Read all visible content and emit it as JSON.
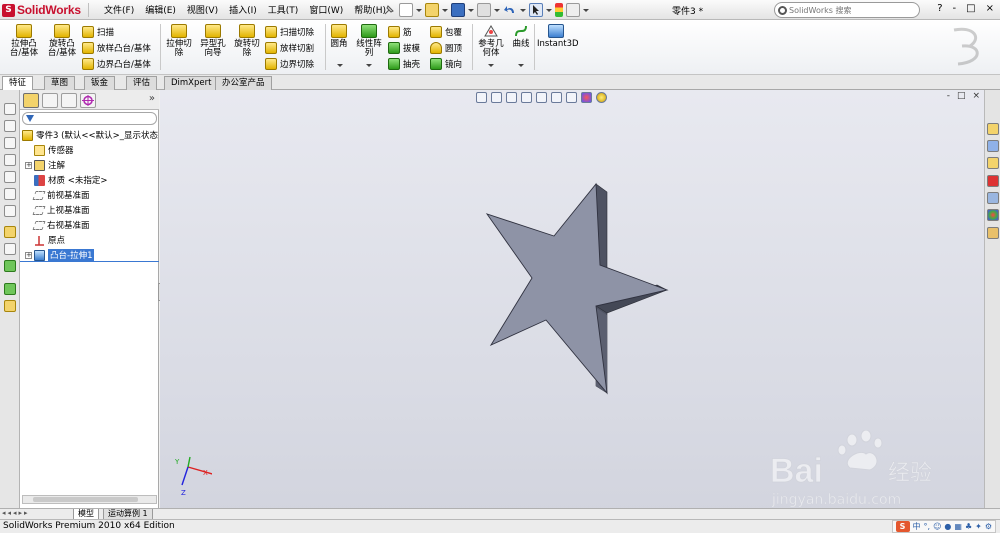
{
  "app": {
    "logo_text": "SolidWorks",
    "document_title": "零件3 *",
    "status_text": "SolidWorks Premium 2010 x64 Edition"
  },
  "menu": [
    "文件(F)",
    "编辑(E)",
    "视图(V)",
    "插入(I)",
    "工具(T)",
    "窗口(W)",
    "帮助(H)"
  ],
  "search": {
    "placeholder": "SolidWorks 搜索"
  },
  "window_controls": [
    "?",
    "-",
    "□",
    "×"
  ],
  "commands": {
    "extrude_boss": "拉伸凸台/基体",
    "revolve_boss": "旋转凸台/基体",
    "sweep": "扫描",
    "loft": "放样凸台/基体",
    "boundary_boss": "边界凸台/基体",
    "extruded_cut": "拉伸切除",
    "hole_wizard": "异型孔向导",
    "revolved_cut": "旋转切除",
    "swept_cut": "扫描切除",
    "lofted_cut": "放样切割",
    "boundary_cut": "边界切除",
    "fillet": "圆角",
    "linear_pattern": "线性阵列",
    "rib": "筋",
    "draft": "拔模",
    "shell": "抽壳",
    "wrap": "包覆",
    "dome": "圆顶",
    "mirror": "镜向",
    "reference_geometry": "参考几何体",
    "curves": "曲线",
    "instant3d": "Instant3D"
  },
  "tabs": [
    "特征",
    "草图",
    "钣金",
    "评估",
    "DimXpert",
    "办公室产品"
  ],
  "tree": {
    "root": "零件3 (默认<<默认>_显示状态",
    "items": [
      {
        "label": "传感器",
        "expandable": false
      },
      {
        "label": "注解",
        "expandable": true
      },
      {
        "label": "材质 <未指定>",
        "expandable": false
      },
      {
        "label": "前视基准面",
        "expandable": false
      },
      {
        "label": "上视基准面",
        "expandable": false
      },
      {
        "label": "右视基准面",
        "expandable": false
      },
      {
        "label": "原点",
        "expandable": false
      },
      {
        "label": "凸台-拉伸1",
        "expandable": true,
        "selected": true
      }
    ]
  },
  "bottom_tabs": [
    "模型",
    "运动算例 1"
  ],
  "triad": {
    "x": "X",
    "y": "Y",
    "z": "Z"
  },
  "watermark": {
    "brand": "Bai",
    "brand_suffix": "经验",
    "url": "jingyan.baidu.com"
  },
  "ime": {
    "chinese": "中",
    "punct": "°,"
  },
  "colors": {
    "viewport_bg": "#dcdee6",
    "star_face": "#8e93a6",
    "star_side": "#4e5262",
    "selection": "#3a78d2",
    "brand_red": "#c8102e"
  }
}
